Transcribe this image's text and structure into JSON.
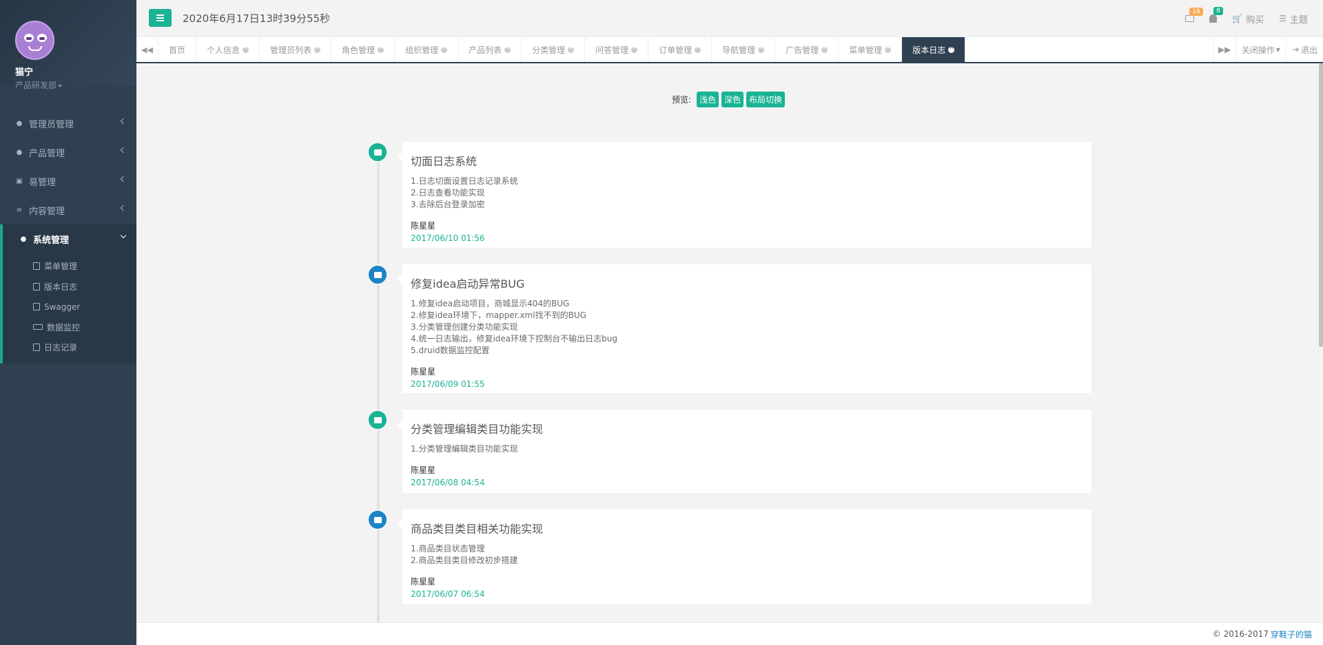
{
  "user": {
    "name": "猫宁",
    "dept": "产品研发部"
  },
  "sidebar": {
    "items": [
      {
        "label": "管理员管理",
        "icon": "user-icon"
      },
      {
        "label": "产品管理",
        "icon": "product-icon"
      },
      {
        "label": "易管理",
        "icon": "money-icon"
      },
      {
        "label": "内容管理",
        "icon": "list-icon"
      },
      {
        "label": "系统管理",
        "icon": "system-icon"
      }
    ],
    "subitems": [
      {
        "label": "菜单管理",
        "icon": "file-icon"
      },
      {
        "label": "版本日志",
        "icon": "file-icon"
      },
      {
        "label": "Swagger",
        "icon": "info-icon"
      },
      {
        "label": "数据监控",
        "icon": "monitor-icon"
      },
      {
        "label": "日志记录",
        "icon": "file-icon"
      }
    ]
  },
  "header": {
    "datetime": "2020年6月17日13时39分55秒",
    "mail_count": "16",
    "bell_count": "8",
    "buy_label": "购买",
    "theme_label": "主题"
  },
  "tabs": [
    {
      "label": "首页"
    },
    {
      "label": "个人信息"
    },
    {
      "label": "管理员列表"
    },
    {
      "label": "角色管理"
    },
    {
      "label": "组织管理"
    },
    {
      "label": "产品列表"
    },
    {
      "label": "分类管理"
    },
    {
      "label": "问答管理"
    },
    {
      "label": "订单管理"
    },
    {
      "label": "导航管理"
    },
    {
      "label": "广告管理"
    },
    {
      "label": "菜单管理"
    },
    {
      "label": "版本日志"
    }
  ],
  "tab_actions": {
    "close_ops": "关闭操作",
    "logout": "退出"
  },
  "preview": {
    "label": "预览:",
    "light": "浅色",
    "dark": "深色",
    "layout": "布局切换"
  },
  "timeline": [
    {
      "title": "切面日志系统",
      "lines": [
        "1.日志切面设置日志记录系统",
        "2.日志查看功能实现",
        "3.去除后台登录加密"
      ],
      "author": "陈星星",
      "date": "2017/06/10 01:56",
      "color": "green",
      "icon": "briefcase-icon"
    },
    {
      "title": "修复idea启动异常BUG",
      "lines": [
        "1.修复idea启动项目，商城显示404的BUG",
        "2.修复idea环境下，mapper.xml找不到的BUG",
        "3.分类管理创建分类功能实现",
        "4.统一日志输出，修复idea环境下控制台不输出日志bug",
        "5.druid数据监控配置"
      ],
      "author": "陈星星",
      "date": "2017/06/09 01:55",
      "color": "blue",
      "icon": "document-icon"
    },
    {
      "title": "分类管理编辑类目功能实现",
      "lines": [
        "1.分类管理编辑类目功能实现"
      ],
      "author": "陈星星",
      "date": "2017/06/08 04:54",
      "color": "green",
      "icon": "briefcase-icon"
    },
    {
      "title": "商品类目类目相关功能实现",
      "lines": [
        "1.商品类目状态管理",
        "2.商品类目类目修改初步搭建"
      ],
      "author": "陈星星",
      "date": "2017/06/07 06:54",
      "color": "blue",
      "icon": "document-icon"
    }
  ],
  "footer": {
    "copyright": "© 2016-2017",
    "link": "穿鞋子的猫"
  },
  "colors": {
    "accent": "#1ab394",
    "sidebar": "#2f4050",
    "blue": "#1c84c6",
    "warning": "#f8ac59"
  }
}
